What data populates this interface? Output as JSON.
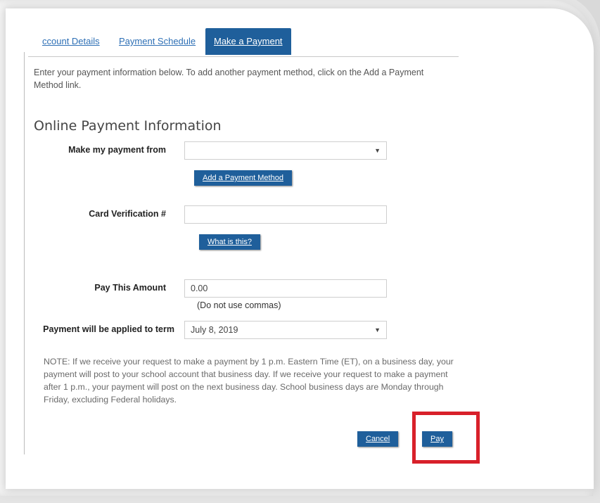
{
  "tabs": [
    {
      "label": "ccount Details"
    },
    {
      "label": "Payment Schedule"
    },
    {
      "label": "Make a Payment"
    }
  ],
  "intro_text": "Enter your payment information below. To add another payment method, click on the Add a Payment Method link.",
  "section_title": "Online Payment Information",
  "form": {
    "payment_from_label": "Make my payment from",
    "payment_from_value": "",
    "add_payment_method_label": "Add a Payment Method",
    "cvv_label": "Card Verification #",
    "cvv_value": "",
    "what_is_this_label": "What is this?",
    "amount_label": "Pay This Amount",
    "amount_value": "0.00",
    "amount_hint": "(Do not use commas)",
    "term_label": "Payment will be applied to term",
    "term_value": "July 8, 2019",
    "caret": "▼"
  },
  "note": "NOTE: If we receive your request to make a payment by 1 p.m. Eastern Time (ET), on a business day, your payment will post to your school account that business day. If we receive your request to make a payment after 1 p.m., your payment will post on the next business day. School business days are Monday through Friday, excluding Federal holidays.",
  "actions": {
    "cancel_label": "Cancel",
    "pay_label": "Pay"
  },
  "colors": {
    "button_blue": "#1f5f9b",
    "link_blue": "#2d6fb5",
    "highlight_red": "#d8202a"
  }
}
